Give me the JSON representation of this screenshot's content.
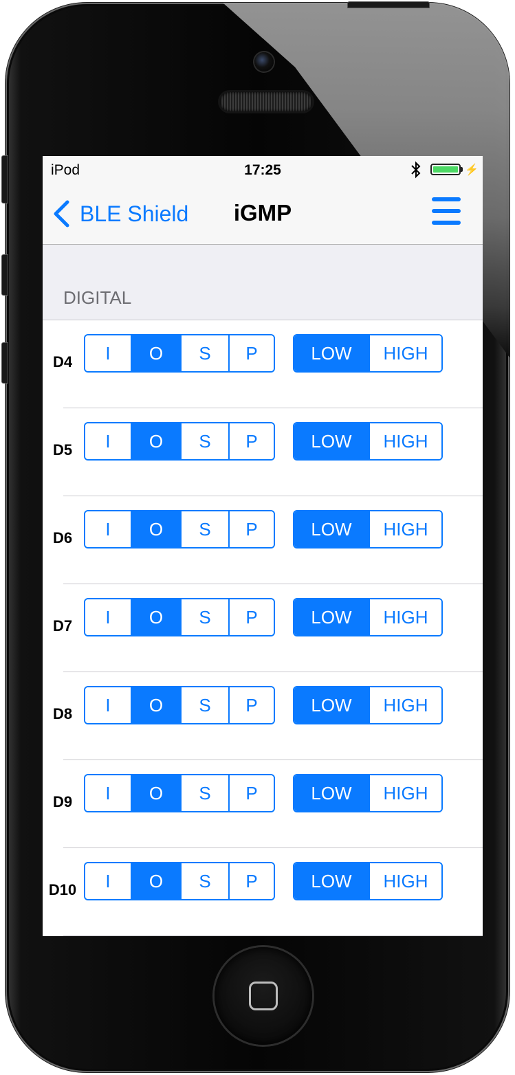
{
  "status_bar": {
    "carrier": "iPod",
    "time": "17:25",
    "bluetooth_icon": "bluetooth-icon",
    "battery_icon": "battery-icon",
    "charging_icon": "charging-bolt-icon",
    "battery_color": "#4cd964"
  },
  "nav": {
    "back_label": "BLE Shield",
    "title": "iGMP",
    "back_icon": "chevron-left-icon",
    "menu_icon": "hamburger-menu-icon",
    "accent": "#0a7aff"
  },
  "section": {
    "label": "DIGITAL"
  },
  "modes": [
    "I",
    "O",
    "S",
    "P"
  ],
  "states": [
    "LOW",
    "HIGH"
  ],
  "pins": [
    {
      "label": "D4",
      "mode": "O",
      "state": "LOW"
    },
    {
      "label": "D5",
      "mode": "O",
      "state": "LOW"
    },
    {
      "label": "D6",
      "mode": "O",
      "state": "LOW"
    },
    {
      "label": "D7",
      "mode": "O",
      "state": "LOW"
    },
    {
      "label": "D8",
      "mode": "O",
      "state": "LOW"
    },
    {
      "label": "D9",
      "mode": "O",
      "state": "LOW"
    },
    {
      "label": "D10",
      "mode": "O",
      "state": "LOW"
    }
  ]
}
